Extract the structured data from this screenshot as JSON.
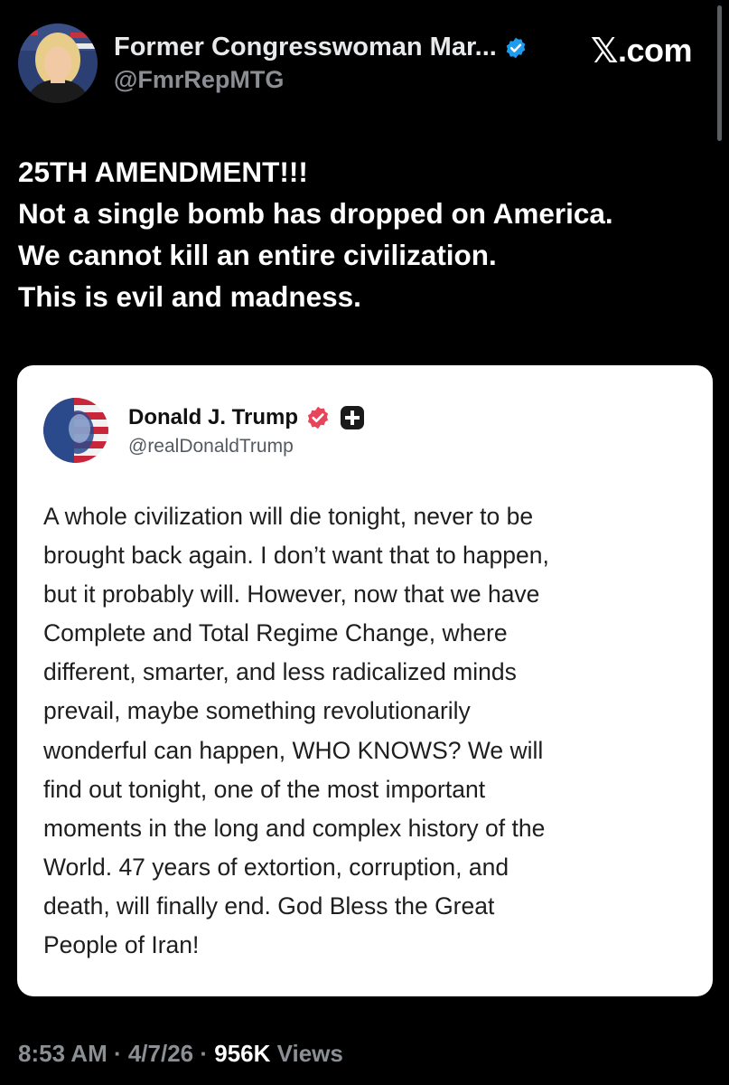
{
  "author": {
    "display_name": "Former Congresswoman Mar...",
    "handle": "@FmrRepMTG",
    "verified_color": "#1d9bf0"
  },
  "brand": {
    "x_glyph": "𝕏",
    "suffix": ".com"
  },
  "tweet": {
    "lines": [
      "25TH AMENDMENT!!!",
      "Not a single bomb has dropped on America.",
      "We cannot kill an entire civilization.",
      "This is evil and madness."
    ]
  },
  "quoted_post": {
    "display_name": "Donald J. Trump",
    "handle": "@realDonaldTrump",
    "badge_color": "#e8445a",
    "body_lines": [
      "A whole civilization will die tonight, never to be",
      "brought back again. I don’t want that to happen,",
      "but it probably will. However, now that we have",
      "Complete and Total Regime Change, where",
      "different, smarter, and less radicalized minds",
      "prevail, maybe something revolutionarily",
      "wonderful can happen, WHO KNOWS? We will",
      "find out tonight, one of the most important",
      "moments in the long and complex history of the",
      "World. 47 years of extortion, corruption, and",
      "death, will finally end. God Bless the Great",
      "People of Iran!"
    ]
  },
  "meta": {
    "time": "8:53 AM",
    "separator": " · ",
    "date": "4/7/26",
    "views_count": "956K",
    "views_label": " Views"
  }
}
